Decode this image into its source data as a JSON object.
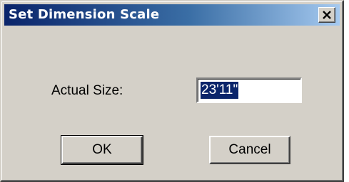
{
  "dialog": {
    "title": "Set Dimension Scale",
    "actual_size_label": "Actual Size:",
    "actual_size_value": "23'11\"",
    "ok_label": "OK",
    "cancel_label": "Cancel"
  }
}
